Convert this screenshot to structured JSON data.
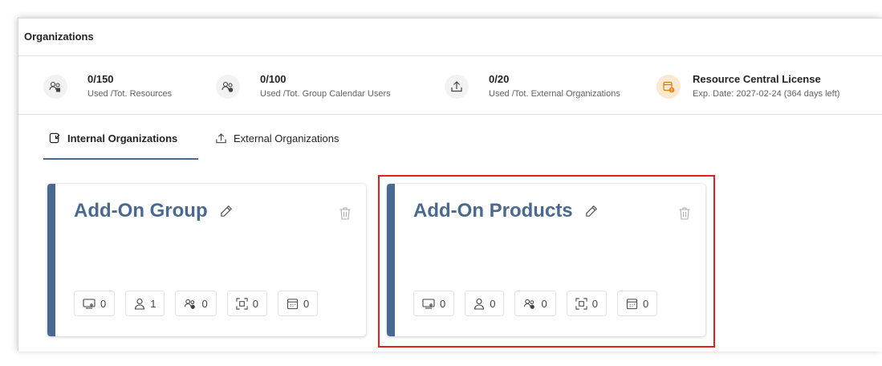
{
  "page": {
    "title": "Organizations"
  },
  "stats": [
    {
      "icon": "resources-icon",
      "value": "0/150",
      "label": "Used /Tot. Resources"
    },
    {
      "icon": "group-calendar-users-icon",
      "value": "0/100",
      "label": "Used /Tot. Group Calendar Users"
    },
    {
      "icon": "external-organizations-icon",
      "value": "0/20",
      "label": "Used /Tot. External Organizations"
    },
    {
      "icon": "license-icon",
      "value": "Resource Central License",
      "label": "Exp. Date: 2027-02-24 (364 days left)"
    }
  ],
  "tabs": [
    {
      "label": "Internal Organizations",
      "icon": "internal-organizations-icon",
      "active": true
    },
    {
      "label": "External Organizations",
      "icon": "external-organizations-icon",
      "active": false
    }
  ],
  "cards": [
    {
      "title": "Add-On Group",
      "counts": {
        "rooms": "0",
        "users": "1",
        "group_users": "0",
        "resources": "0",
        "calendars": "0"
      }
    },
    {
      "title": "Add-On Products",
      "counts": {
        "rooms": "0",
        "users": "0",
        "group_users": "0",
        "resources": "0",
        "calendars": "0"
      }
    }
  ],
  "colors": {
    "accent": "#4a6990",
    "highlight": "#e02020",
    "license_icon_bg": "#fde9d2"
  }
}
